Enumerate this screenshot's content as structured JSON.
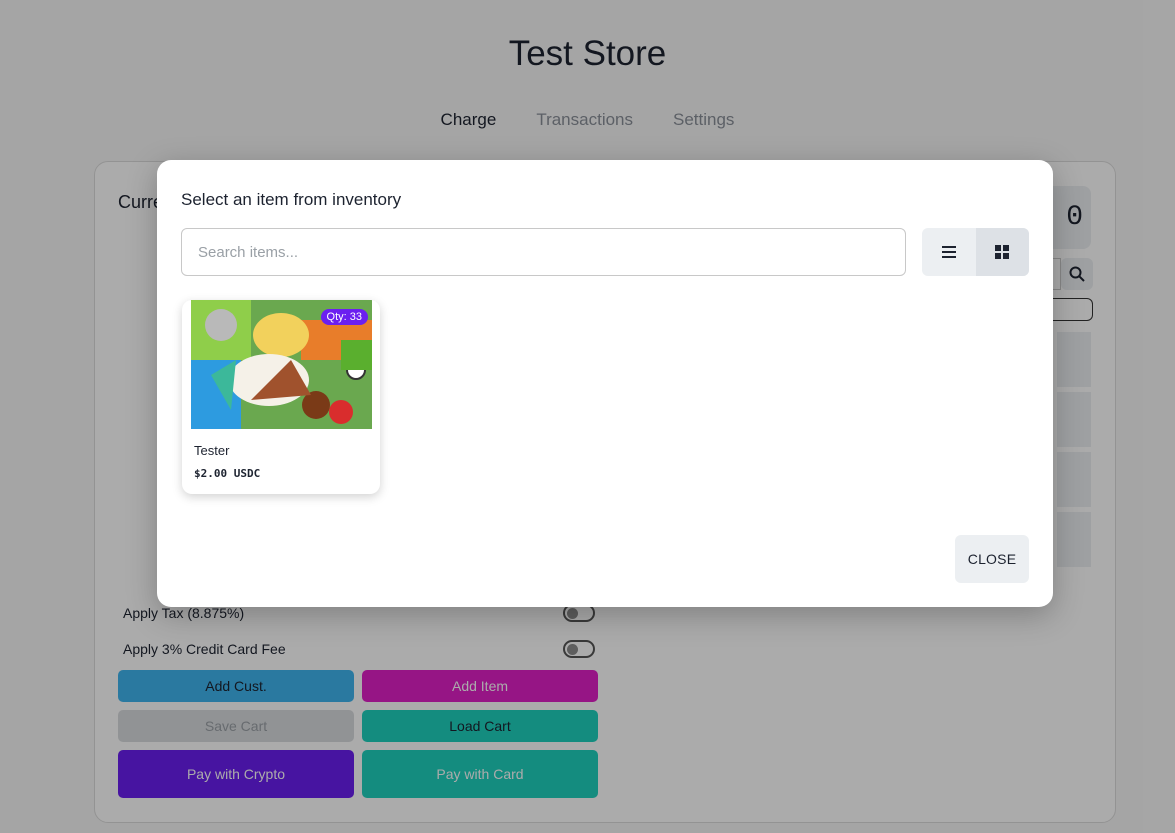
{
  "store": {
    "title": "Test Store"
  },
  "tabs": [
    {
      "label": "Charge",
      "active": true
    },
    {
      "label": "Transactions",
      "active": false
    },
    {
      "label": "Settings",
      "active": false
    }
  ],
  "panel": {
    "currency_label": "Curre",
    "amount_tail": "0",
    "toggles": [
      {
        "label": "Apply Tax (8.875%)",
        "on": false
      },
      {
        "label": "Apply 3% Credit Card Fee",
        "on": false
      }
    ],
    "buttons": {
      "add_customer": "Add Cust.",
      "add_item": "Add Item",
      "save_cart": "Save Cart",
      "load_cart": "Load Cart",
      "pay_crypto": "Pay with Crypto",
      "pay_card": "Pay with Card"
    },
    "colors": {
      "add_customer": "#3fb5ef",
      "add_item": "#e020c6",
      "save_cart": "#d9dbde",
      "load_cart": "#1ed1be",
      "pay_crypto": "#6b1ff0",
      "pay_card": "#1ed1be"
    }
  },
  "modal": {
    "title": "Select an item from inventory",
    "search_placeholder": "Search items...",
    "view_modes": [
      {
        "icon": "list-icon",
        "active": false
      },
      {
        "icon": "grid-icon",
        "active": true
      }
    ],
    "items": [
      {
        "name": "Tester",
        "price": "$2.00 USDC",
        "qty": "Qty: 33"
      }
    ],
    "close_label": "CLOSE"
  }
}
